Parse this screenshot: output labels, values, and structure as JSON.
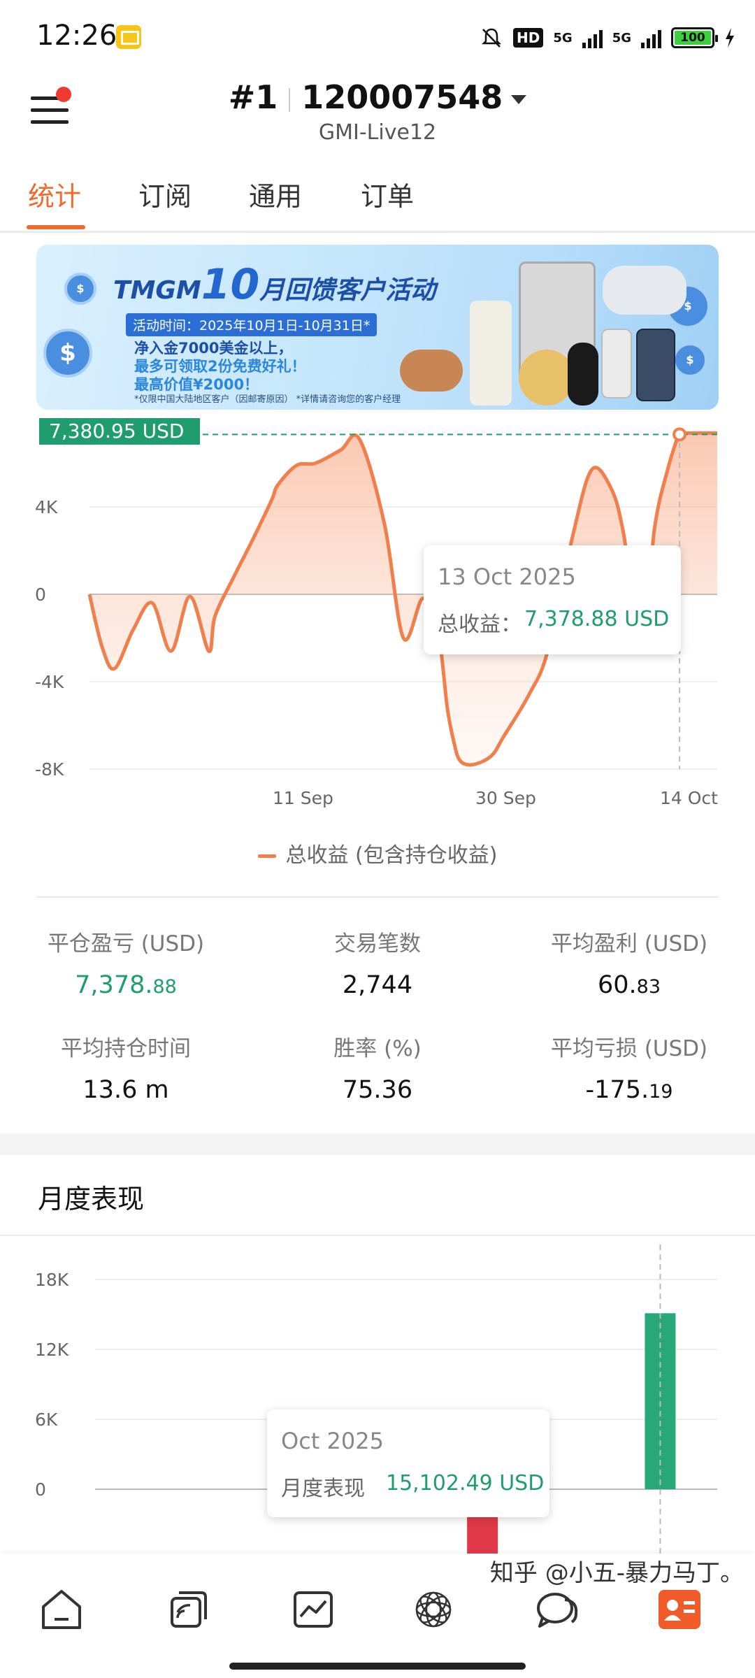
{
  "status_bar": {
    "time": "12:26",
    "network1": "5G",
    "network2": "5G",
    "hd": "HD",
    "battery": "100"
  },
  "header": {
    "account_index": "#1",
    "account_number": "120007548",
    "server": "GMI-Live12"
  },
  "tabs": [
    {
      "label": "统计",
      "active": true
    },
    {
      "label": "订阅",
      "active": false
    },
    {
      "label": "通用",
      "active": false
    },
    {
      "label": "订单",
      "active": false
    }
  ],
  "banner": {
    "brand": "TMGM",
    "big_number": "10",
    "headline": "月回馈客户活动",
    "date": "活动时间：2025年10月1日-10月31日*",
    "line1": "净入金7000美金以上，",
    "line2": "最多可领取2份免费好礼！",
    "line3": "最高价值¥2000！",
    "note": "*仅限中国大陆地区客户（因邮寄原因）  *详情请咨询您的客户经理"
  },
  "pnl_chart": {
    "max_label": "7,380.95 USD",
    "tooltip_date": "13 Oct 2025",
    "tooltip_label": "总收益：",
    "tooltip_value": "7,378.88 USD",
    "legend": "总收益 (包含持仓收益)",
    "line_color": "#f17f4c",
    "positive_color": "#1f9d6e"
  },
  "chart_data": [
    {
      "type": "area",
      "xlabel": "",
      "ylabel": "",
      "x_ticks": [
        "11 Sep",
        "30 Sep",
        "14 Oct"
      ],
      "y_ticks": [
        "4K",
        "0",
        "-4K",
        "-8K"
      ],
      "ylim": [
        -8000,
        8000
      ],
      "series": [
        {
          "name": "总收益 (包含持仓收益)",
          "x_index": [
            0,
            0.02,
            0.04,
            0.07,
            0.1,
            0.13,
            0.16,
            0.19,
            0.2,
            0.23,
            0.26,
            0.29,
            0.3,
            0.33,
            0.36,
            0.4,
            0.43,
            0.47,
            0.5,
            0.53,
            0.55,
            0.56,
            0.57,
            0.58,
            0.59,
            0.61,
            0.64,
            0.66,
            0.7,
            0.73,
            0.77,
            0.8,
            0.83,
            0.85,
            0.88,
            0.9,
            0.92,
            0.94,
            0.95,
            0.97,
            1.0
          ],
          "values": [
            0,
            -2400,
            -3400,
            -1600,
            -400,
            -2600,
            -100,
            -2600,
            -1000,
            800,
            2500,
            4300,
            5000,
            5900,
            6000,
            6600,
            7100,
            3200,
            -2000,
            -200,
            -1100,
            -2600,
            -5200,
            -6700,
            -7600,
            -7800,
            -7400,
            -6500,
            -4600,
            -2600,
            2700,
            5700,
            4900,
            2900,
            -2300,
            3000,
            5600,
            7380,
            7380,
            7380,
            7380
          ]
        }
      ],
      "highlight": {
        "x": "13 Oct 2025",
        "value": 7378.88
      },
      "max": 7380.95
    },
    {
      "type": "bar",
      "title": "月度表现",
      "y_ticks": [
        "18K",
        "12K",
        "6K",
        "0"
      ],
      "ylim": [
        -6000,
        18000
      ],
      "categories": [
        "",
        "",
        "",
        "",
        "",
        "",
        "Oct 2025"
      ],
      "series": [
        {
          "name": "月度表现",
          "values": [
            0,
            0,
            0,
            0,
            -6000,
            0,
            15102.49
          ]
        }
      ],
      "highlight": {
        "x": "Oct 2025",
        "value": 15102.49
      }
    }
  ],
  "stats": [
    {
      "label": "平仓盈亏 (USD)",
      "value_main": "7,378.",
      "value_small": ".88",
      "color": "green"
    },
    {
      "label": "交易笔数",
      "value_main": "2,744",
      "value_small": "",
      "color": "default"
    },
    {
      "label": "平均盈利 (USD)",
      "value_main": "60.",
      "value_small": "83",
      "color": "default"
    },
    {
      "label": "平均持仓时间",
      "value_main": "13.6 m",
      "value_small": "",
      "color": "default"
    },
    {
      "label": "胜率 (%)",
      "value_main": "75.36",
      "value_small": "",
      "color": "default"
    },
    {
      "label": "平均亏损 (USD)",
      "value_main": "-175.",
      "value_small": "19",
      "color": "default"
    }
  ],
  "monthly": {
    "title": "月度表现",
    "tooltip_date": "Oct 2025",
    "tooltip_label": "月度表现",
    "tooltip_value": "15,102.49 USD"
  },
  "bottom_nav": {
    "items": [
      "home-icon",
      "copy-trading-icon",
      "chart-icon",
      "discover-icon",
      "chat-icon",
      "account-card-icon"
    ],
    "watermark": "知乎 @小五-暴力马丁。"
  }
}
